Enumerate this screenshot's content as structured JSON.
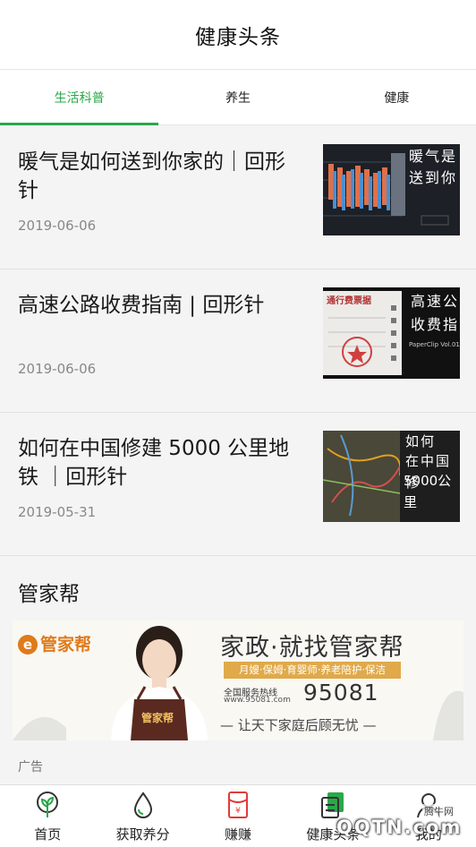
{
  "header": {
    "title": "健康头条"
  },
  "tabs": [
    {
      "label": "生活科普",
      "active": true
    },
    {
      "label": "养生",
      "active": false
    },
    {
      "label": "健康",
      "active": false
    }
  ],
  "articles": [
    {
      "title": "暖气是如何送到你家的｜回形针",
      "date": "2019-06-06",
      "thumb_text": [
        "暖气是",
        "送到你"
      ]
    },
    {
      "title": "高速公路收费指南 | 回形针",
      "date": "2019-06-06",
      "thumb_text": [
        "高速公",
        "收费指"
      ],
      "thumb_ticket": "通行费票据",
      "thumb_caption": "PaperClip Vol.01"
    },
    {
      "title": "如何在中国修建 5000 公里地铁 ｜回形针",
      "date": "2019-05-31",
      "thumb_text": [
        "如何",
        "在中国修",
        "5000公里"
      ]
    }
  ],
  "section": {
    "title": "管家帮"
  },
  "banner": {
    "logo": "管家帮",
    "logo_mark": "e",
    "headline": "家政·就找管家帮",
    "services": "月嫂·保姆·育婴师·养老陪护·保洁",
    "hotline_label": "全国服务热线",
    "hotline_url": "www.95081.com",
    "hotline_number": "95081",
    "slogan": "— 让天下家庭后顾无忧 —",
    "apron_text": "管家帮"
  },
  "ad_label": "广告",
  "bottom_nav": [
    {
      "label": "首页",
      "icon": "home-sprout-icon"
    },
    {
      "label": "获取养分",
      "icon": "water-drop-icon"
    },
    {
      "label": "赚赚",
      "icon": "red-envelope-icon"
    },
    {
      "label": "健康头条",
      "icon": "news-icon"
    },
    {
      "label": "我的",
      "icon": "user-icon"
    }
  ],
  "watermark": {
    "small": "腾牛网",
    "big": "QQTN.com"
  },
  "colors": {
    "accent": "#2aa84a",
    "banner_orange": "#e07a1a",
    "banner_gold": "#e0a94a",
    "envelope_red": "#e23b3b"
  }
}
